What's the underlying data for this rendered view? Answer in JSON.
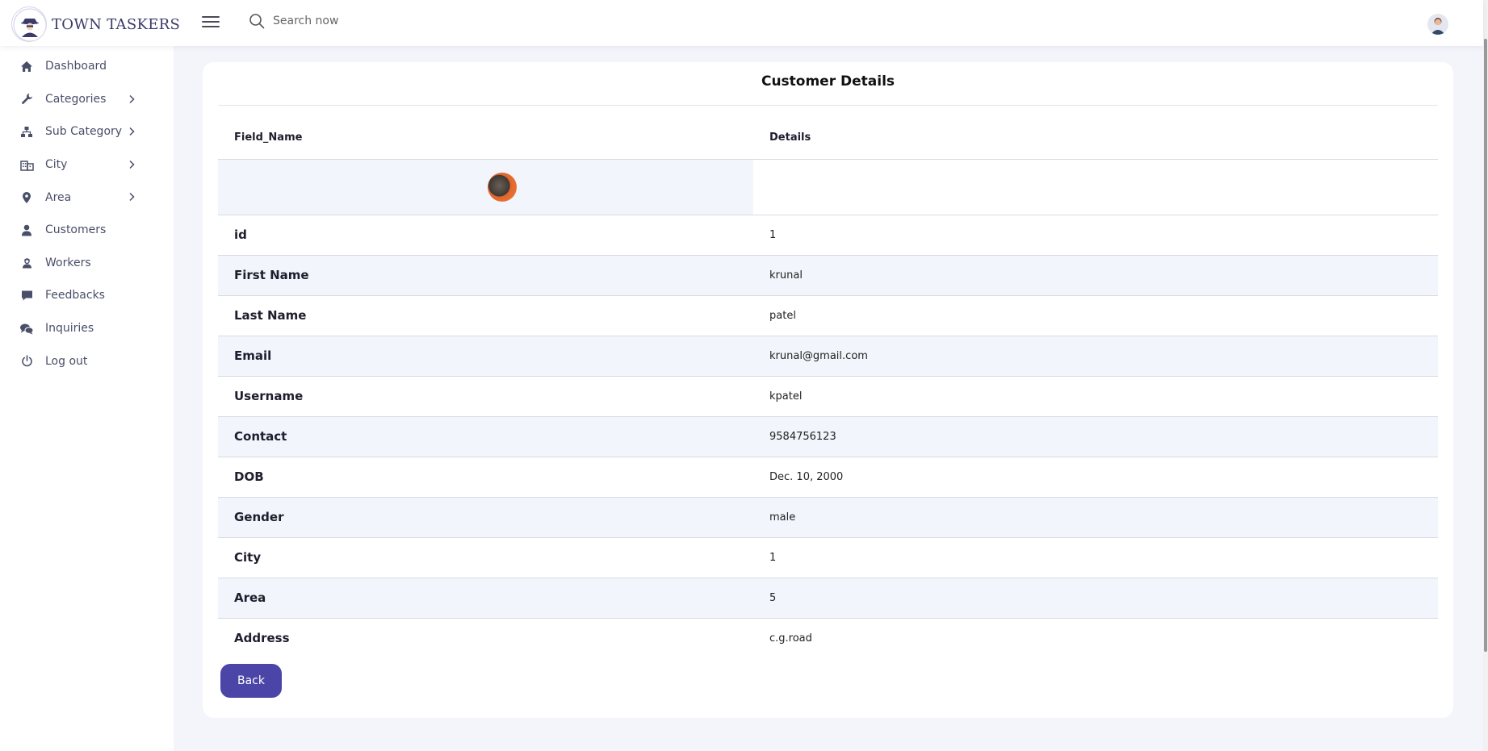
{
  "header": {
    "brand": "TOWN TASKERS",
    "search_placeholder": "Search now"
  },
  "icons": {
    "logo": "detective-logo-icon",
    "menu": "hamburger-menu-icon",
    "search": "search-icon",
    "avatar": "user-avatar-icon"
  },
  "sidebar": {
    "items": [
      {
        "label": "Dashboard",
        "icon": "home-icon",
        "has_submenu": false
      },
      {
        "label": "Categories",
        "icon": "wrench-icon",
        "has_submenu": true
      },
      {
        "label": "Sub Category",
        "icon": "sitemap-icon",
        "has_submenu": true
      },
      {
        "label": "City",
        "icon": "building-icon",
        "has_submenu": true
      },
      {
        "label": "Area",
        "icon": "map-pin-icon",
        "has_submenu": true
      },
      {
        "label": "Customers",
        "icon": "user-icon",
        "has_submenu": false
      },
      {
        "label": "Workers",
        "icon": "worker-icon",
        "has_submenu": false
      },
      {
        "label": "Feedbacks",
        "icon": "comment-icon",
        "has_submenu": false
      },
      {
        "label": "Inquiries",
        "icon": "comments-icon",
        "has_submenu": false
      },
      {
        "label": "Log out",
        "icon": "power-icon",
        "has_submenu": false
      }
    ]
  },
  "card": {
    "title": "Customer Details",
    "columns": [
      "Field_Name",
      "Details"
    ],
    "rows": [
      {
        "field": "id",
        "value": "1"
      },
      {
        "field": "First Name",
        "value": "krunal"
      },
      {
        "field": "Last Name",
        "value": "patel"
      },
      {
        "field": "Email",
        "value": "krunal@gmail.com"
      },
      {
        "field": "Username",
        "value": "kpatel"
      },
      {
        "field": "Contact",
        "value": "9584756123"
      },
      {
        "field": "DOB",
        "value": "Dec. 10, 2000"
      },
      {
        "field": "Gender",
        "value": "male"
      },
      {
        "field": "City",
        "value": "1"
      },
      {
        "field": "Area",
        "value": "5"
      },
      {
        "field": "Address",
        "value": "c.g.road"
      }
    ],
    "back_label": "Back"
  },
  "colors": {
    "accent": "#4b45a8",
    "sidebar_text": "#4a4f69",
    "page_bg": "#f4f5fb",
    "stripe": "#f2f5fb"
  }
}
